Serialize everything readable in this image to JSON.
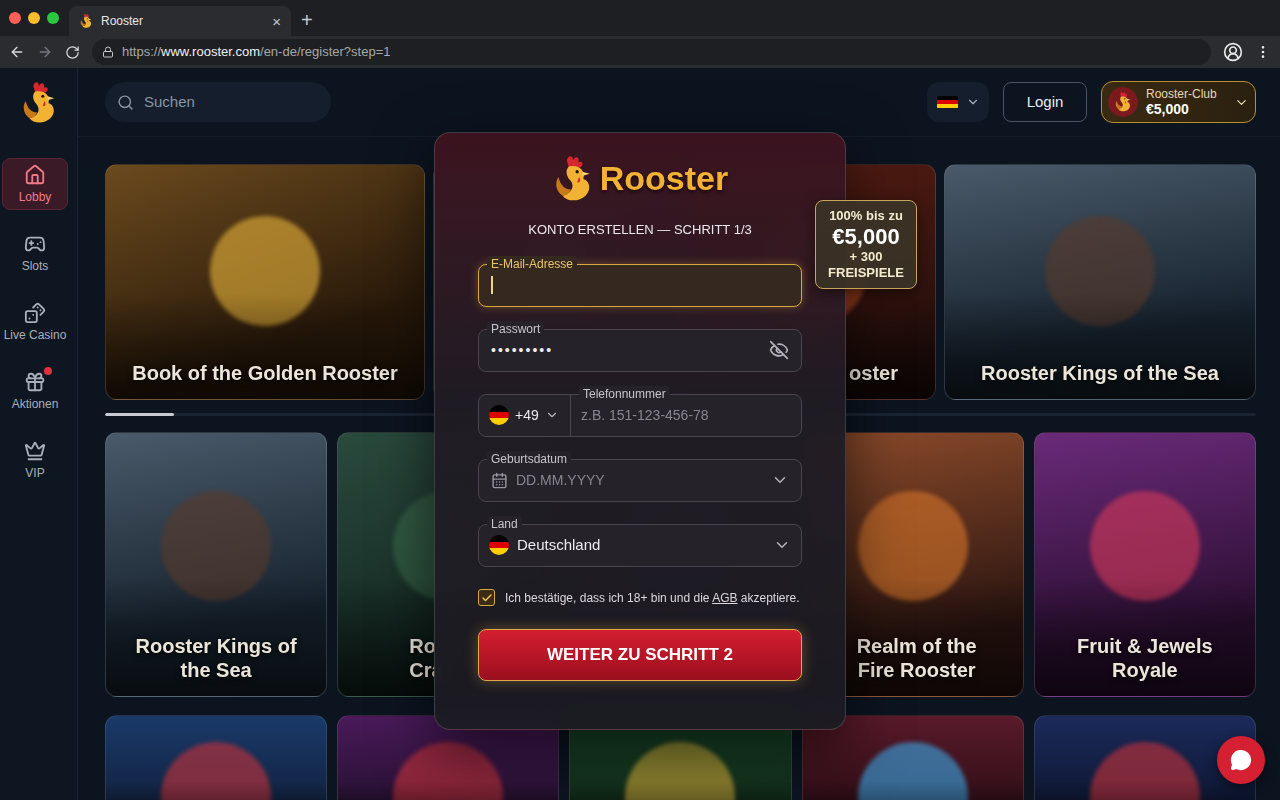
{
  "browser": {
    "tab": {
      "title": "Rooster",
      "close": "×"
    },
    "new_tab": "+",
    "url": {
      "scheme": "https://",
      "host": "www.rooster.com",
      "path": "/en-de/register?step=1"
    }
  },
  "search": {
    "placeholder": "Suchen"
  },
  "sidebar": {
    "items": [
      {
        "label": "Lobby",
        "selected": true,
        "badge": false
      },
      {
        "label": "Slots",
        "selected": false,
        "badge": false
      },
      {
        "label": "Live Casino",
        "selected": false,
        "badge": false
      },
      {
        "label": "Aktionen",
        "selected": false,
        "badge": true
      },
      {
        "label": "VIP",
        "selected": false,
        "badge": false
      }
    ]
  },
  "header": {
    "login": "Login",
    "club": {
      "label": "Rooster-Club",
      "amount": "€5,000"
    }
  },
  "games": {
    "rows": [
      [
        {
          "lines": [
            "Book of the Golden Rooster"
          ]
        },
        {
          "lines": []
        },
        {
          "lines": [
            "oster"
          ]
        },
        {
          "lines": [
            "Rooster Kings of the Sea"
          ]
        }
      ],
      [
        {
          "lines": [
            "Rooster Kings of",
            "the Sea"
          ]
        },
        {
          "lines": [
            "Ro",
            "Cra"
          ]
        },
        {
          "lines": []
        },
        {
          "lines": [
            "Realm of the",
            "Fire Rooster"
          ]
        },
        {
          "lines": [
            "Fruit & Jewels",
            "Royale"
          ]
        }
      ],
      [
        {
          "lines": []
        },
        {
          "lines": []
        },
        {
          "lines": []
        },
        {
          "lines": []
        },
        {
          "lines": []
        }
      ]
    ]
  },
  "carousel": {
    "level": 0.06
  },
  "modal": {
    "logo": "Rooster",
    "heading": "KONTO ERSTELLEN — SCHRITT 1/3",
    "fields": [
      {
        "kind": "text",
        "label": "E-Mail-Adresse",
        "focused": true
      },
      {
        "kind": "password",
        "label": "Passwort",
        "value": "•••••••••",
        "focused": false,
        "revealed": false
      },
      {
        "kind": "phone",
        "label": "Telefonnummer",
        "prefix": "+49",
        "placeholder": "z.B. 151-123-456-78",
        "focused": false
      },
      {
        "kind": "date",
        "label": "Geburtsdatum",
        "placeholder": "DD.MM.YYYY",
        "focused": false
      },
      {
        "kind": "select",
        "label": "Land",
        "value": "Deutschland",
        "focused": false
      }
    ],
    "consent": {
      "checked": true,
      "before": "Ich bestätige, dass ich 18+ bin und die ",
      "link": "AGB",
      "after": " akzeptiere."
    },
    "submit": "WEITER ZU SCHRITT 2"
  },
  "promo": {
    "line1": "100% bis zu",
    "amount": "€5,000",
    "line3": "+ 300",
    "line4": "FREISPIELE"
  }
}
